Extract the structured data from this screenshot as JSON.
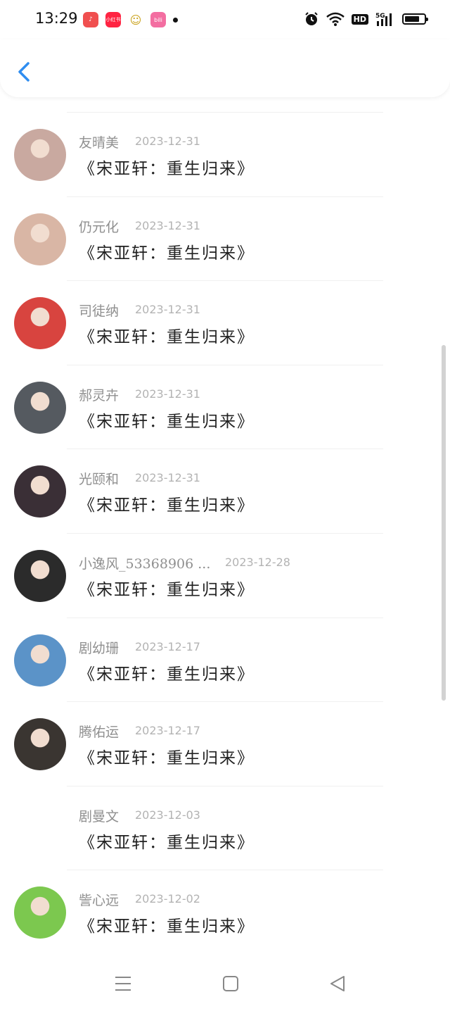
{
  "status_bar": {
    "time": "13:29",
    "app_icons": [
      {
        "name": "douyin-icon",
        "label": "♪",
        "color": "#f04f4f"
      },
      {
        "name": "xiaohongshu-icon",
        "label": "小红书",
        "color": "#ff2442"
      },
      {
        "name": "cartoon-app-icon",
        "label": "☺",
        "color": "#f7d64a"
      },
      {
        "name": "bilibili-icon",
        "label": "bili",
        "color": "#f36ea1"
      }
    ],
    "hd_label": "HD",
    "network_label": "5G",
    "battery_level": 0.75
  },
  "colors": {
    "accent": "#2f8df0"
  },
  "comments": [
    {
      "name": "友晴美",
      "date": "2023-12-31",
      "title": "《宋亚轩：重生归来》",
      "avatar": "#c9a9a0"
    },
    {
      "name": "仍元化",
      "date": "2023-12-31",
      "title": "《宋亚轩：重生归来》",
      "avatar": "#d9b6a5"
    },
    {
      "name": "司徒纳",
      "date": "2023-12-31",
      "title": "《宋亚轩：重生归来》",
      "avatar": "#d8443f"
    },
    {
      "name": "郝灵卉",
      "date": "2023-12-31",
      "title": "《宋亚轩：重生归来》",
      "avatar": "#555a60"
    },
    {
      "name": "光颐和",
      "date": "2023-12-31",
      "title": "《宋亚轩：重生归来》",
      "avatar": "#3a2f36"
    },
    {
      "name": "小逸风_53368906 ...",
      "date": "2023-12-28",
      "title": "《宋亚轩：重生归来》",
      "avatar": "#2b2b2b"
    },
    {
      "name": "剧幼珊",
      "date": "2023-12-17",
      "title": "《宋亚轩：重生归来》",
      "avatar": "#5b93c8"
    },
    {
      "name": "腾佑运",
      "date": "2023-12-17",
      "title": "《宋亚轩：重生归来》",
      "avatar": "#3a3531"
    },
    {
      "name": "剧曼文",
      "date": "2023-12-03",
      "title": "《宋亚轩：重生归来》",
      "avatar": "#ffffff"
    },
    {
      "name": "訾心远",
      "date": "2023-12-02",
      "title": "《宋亚轩：重生归来》",
      "avatar": "#7cc84f"
    }
  ]
}
